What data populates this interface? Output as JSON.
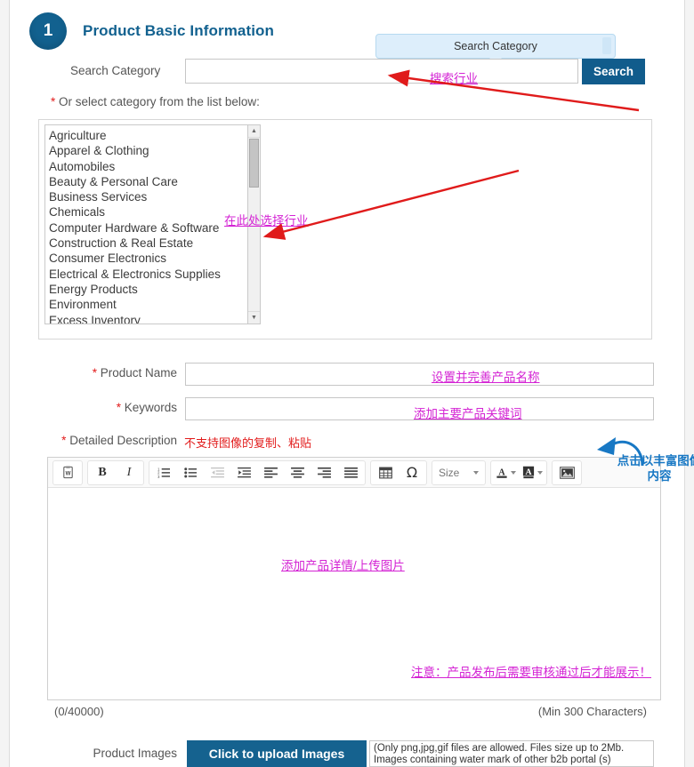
{
  "header": {
    "step_number": "1",
    "title": "Product Basic Information"
  },
  "tooltip": {
    "text": "Search Category"
  },
  "search": {
    "label": "Search Category",
    "value": "",
    "button_label": "Search",
    "annotation": "搜索行业"
  },
  "category": {
    "or_label_required": "*",
    "or_label": " Or select category from the list below:",
    "annotation": "在此处选择行业",
    "items": [
      "Agriculture",
      "Apparel & Clothing",
      "Automobiles",
      "Beauty & Personal Care",
      "Business Services",
      "Chemicals",
      "Computer Hardware & Software",
      "Construction & Real Estate",
      "Consumer Electronics",
      "Electrical & Electronics Supplies",
      "Energy Products",
      "Environment",
      "Excess Inventory"
    ]
  },
  "product_name": {
    "required": "*",
    "label": " Product Name",
    "value": "",
    "annotation": "设置并完善产品名称"
  },
  "keywords": {
    "required": "*",
    "label": " Keywords",
    "value": "",
    "annotation": "添加主要产品关键词"
  },
  "description": {
    "required": "*",
    "label": " Detailed Description",
    "note": "不支持图像的复制、粘贴",
    "body_annotation": "添加产品详情/上传图片",
    "warning_annotation": "注意：产品发布后需要审核通过后才能展示！",
    "counter": "(0/40000)",
    "min_chars": "(Min 300 Characters)",
    "image_hint": "点击以丰富图像内容"
  },
  "toolbar": {
    "paste_from_word": "paste-from-word-icon",
    "bold": "B",
    "italic": "I",
    "numbered_list": "numbered-list-icon",
    "bulleted_list": "bulleted-list-icon",
    "decrease_indent": "decrease-indent-icon",
    "increase_indent": "increase-indent-icon",
    "align_left": "align-left-icon",
    "align_center": "align-center-icon",
    "align_right": "align-right-icon",
    "align_justify": "align-justify-icon",
    "table": "table-icon",
    "special_char": "Ω",
    "size_label": "Size",
    "text_color": "A",
    "bg_color": "A",
    "image": "image-icon"
  },
  "product_images": {
    "label": "Product Images",
    "button_label": "Click to upload Images",
    "note": "(Only png,jpg,gif files are allowed. Files size up to 2Mb. Images containing water mark of other b2b portal (s)"
  },
  "colors": {
    "brand_blue": "#12618f",
    "annotation_magenta": "#d424d4",
    "annotation_red": "#e21b1b",
    "annotation_blue": "#1878c4",
    "arrow_red": "#e01b1b",
    "tooltip_bg": "#ddeefb"
  }
}
